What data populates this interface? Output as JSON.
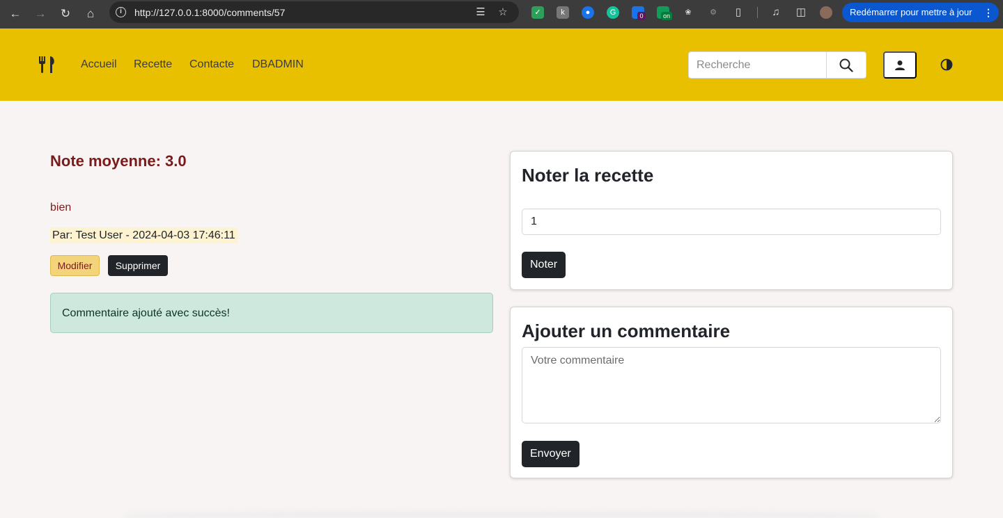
{
  "browser": {
    "url": "http://127.0.0.1:8000/comments/57",
    "restart_label": "Redémarrer pour mettre à jour",
    "extension_badges": [
      "0",
      "on"
    ]
  },
  "navbar": {
    "links": [
      "Accueil",
      "Recette",
      "Contacte",
      "DBADMIN"
    ],
    "search_placeholder": "Recherche",
    "background": "#e9c000"
  },
  "summary": {
    "average_rating": "Note moyenne: 3.0"
  },
  "comment": {
    "text": "bien",
    "meta": "Par: Test User - 2024-04-03 17:46:11",
    "edit_label": "Modifier",
    "delete_label": "Supprimer"
  },
  "alert": {
    "message": "Commentaire ajouté avec succès!"
  },
  "rate_card": {
    "title": "Noter la recette",
    "rating_value": "1",
    "submit_label": "Noter"
  },
  "comment_card": {
    "title": "Ajouter un commentaire",
    "placeholder": "Votre commentaire",
    "submit_label": "Envoyer"
  }
}
